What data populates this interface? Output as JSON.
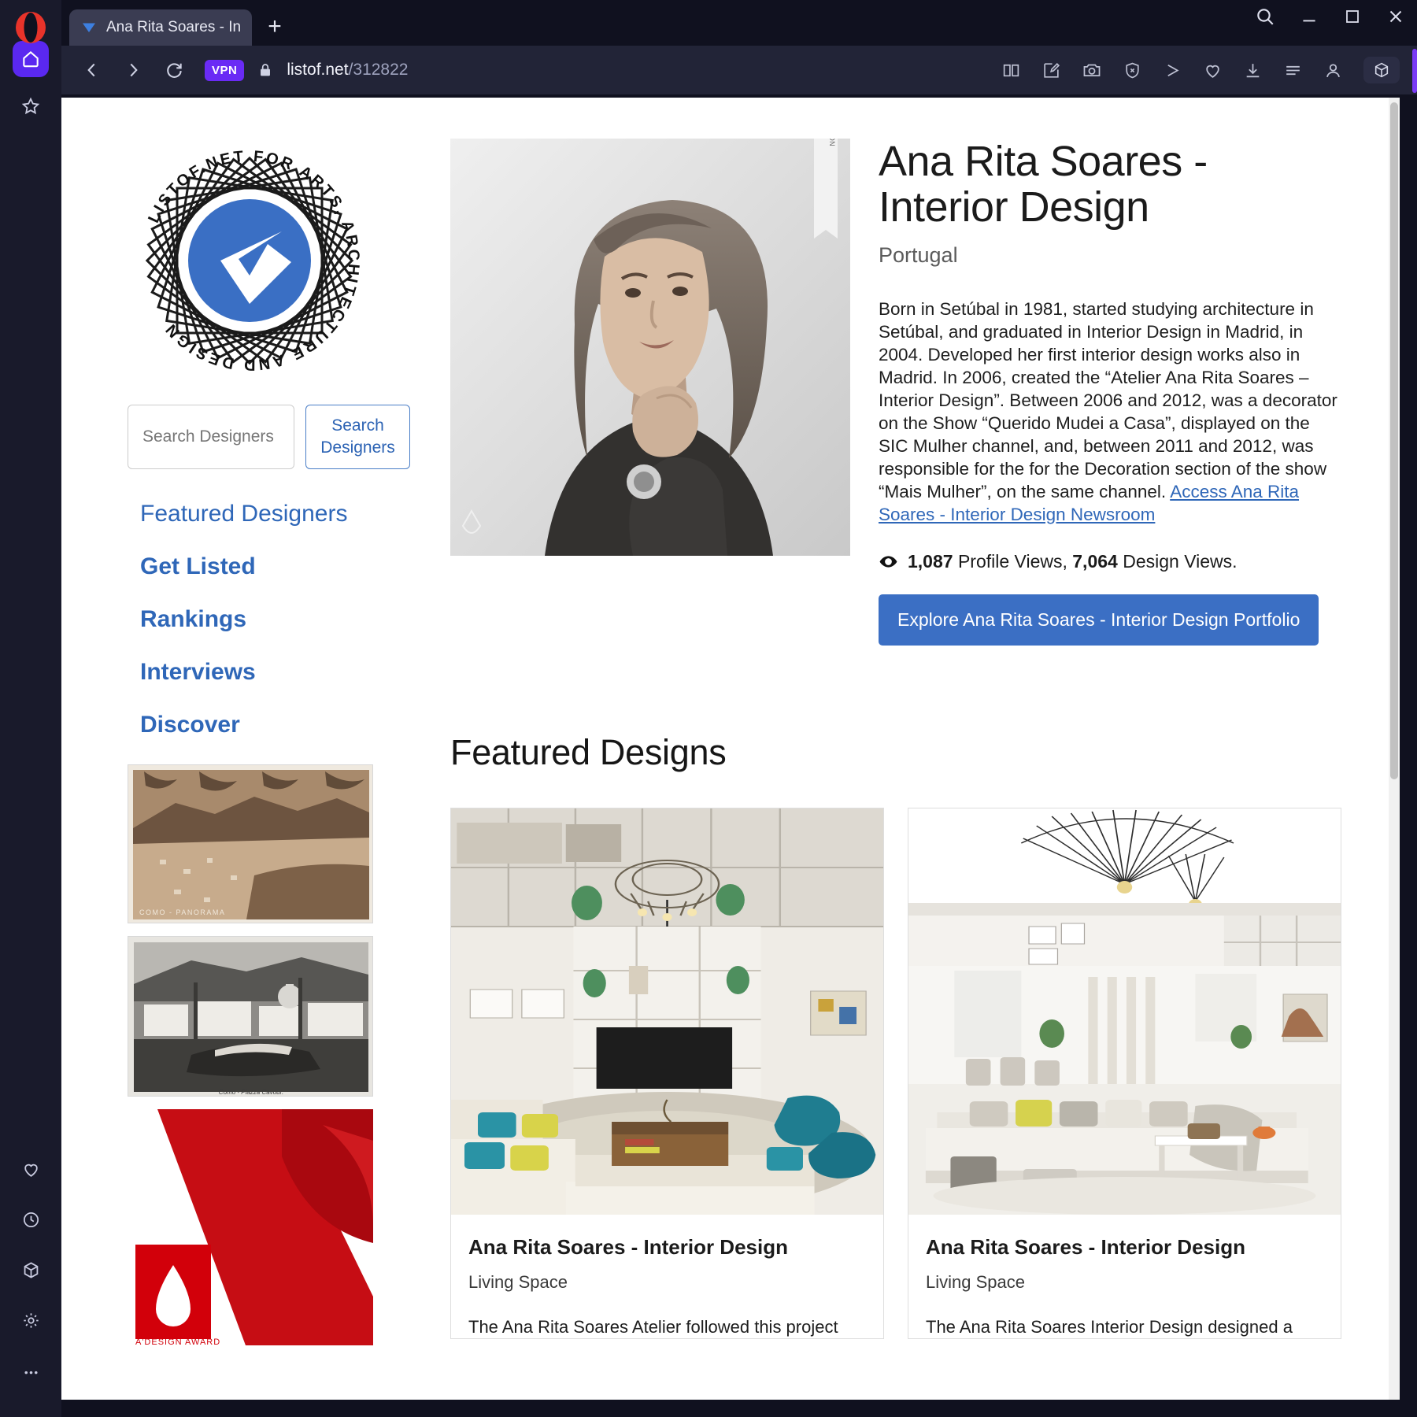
{
  "browser": {
    "tab": {
      "title": "Ana Rita Soares - Interior",
      "favicon": "listof-chevron-icon"
    },
    "new_tab_label": "+",
    "window_controls": {
      "search": "search-icon",
      "minimize": "minimize-icon",
      "maximize": "maximize-icon",
      "close": "close-icon"
    },
    "nav": {
      "back": "back-arrow-icon",
      "forward": "forward-arrow-icon",
      "reload": "reload-icon"
    },
    "vpn_badge": "VPN",
    "lock": "padlock-icon",
    "url_domain": "listof.net",
    "url_path": "/312822",
    "toolbar_icons": [
      "reader-mode-icon",
      "snapshot-edit-icon",
      "camera-icon",
      "shield-blocker-icon",
      "player-icon",
      "heart-icon",
      "downloads-icon",
      "menu-lines-icon",
      "profile-icon",
      "workspace-cube-icon"
    ],
    "rail_icons": [
      "opera-logo-icon",
      "home-icon",
      "star-icon",
      "heart-icon",
      "history-clock-icon",
      "cube-icon",
      "gear-icon",
      "more-dots-icon"
    ],
    "accent_purple": "#6a2bf5",
    "chrome_bg": "#191a2b"
  },
  "sidebar": {
    "logo_text_ring": "LISTOF.NET FOR ARTS, ARCHITECTURE AND DESIGN",
    "search": {
      "placeholder": "Search Designers",
      "value": "",
      "button_label": "Search Designers"
    },
    "nav_items": [
      {
        "label": "Featured Designers",
        "bold": false
      },
      {
        "label": "Get Listed",
        "bold": true
      },
      {
        "label": "Rankings",
        "bold": true
      },
      {
        "label": "Interviews",
        "bold": true
      },
      {
        "label": "Discover",
        "bold": true
      }
    ],
    "thumbnails": [
      {
        "name": "como-panorama-postcard",
        "caption": "COMO - PANORAMA"
      },
      {
        "name": "como-piazza-cavour-postcard",
        "caption": "Como - Piazza Cavour."
      },
      {
        "name": "a-design-award-banner",
        "caption": "A'DESIGN AWARD"
      }
    ],
    "link_color": "#2f67b8"
  },
  "profile": {
    "photo_ribbon": "A'DESIGN AWARD & COMPETITION",
    "name": "Ana Rita Soares - Interior Design",
    "country": "Portugal",
    "bio_before_link": "Born in Setúbal in 1981, started studying architecture in Setúbal, and graduated in Interior Design in Madrid, in 2004. Developed her first interior design works also in Madrid. In 2006, created the “Atelier Ana Rita Soares – Interior Design”. Between 2006 and 2012, was a decorator on the Show “Querido Mudei a Casa”, displayed on the SIC Mulher channel, and, between 2011 and 2012, was responsible for the for the Decoration section of the show “Mais Mulher”, on the same channel. ",
    "bio_link_text": "Access Ana Rita Soares - Interior Design Newsroom",
    "stats": {
      "eye_icon": "eye-icon",
      "profile_views": "1,087",
      "profile_views_label": " Profile Views, ",
      "design_views": "7,064",
      "design_views_label": " Design Views."
    },
    "cta_label": "Explore Ana Rita Soares - Interior Design Portfolio",
    "cta_color": "#3b6fc4"
  },
  "featured": {
    "heading": "Featured Designs",
    "cards": [
      {
        "image_name": "luxury-double-height-living-room",
        "title": "Ana Rita Soares - Interior Design",
        "subtitle": "Living Space",
        "description": "The Ana Rita Soares Atelier followed this project"
      },
      {
        "image_name": "white-open-plan-living-room",
        "title": "Ana Rita Soares - Interior Design",
        "subtitle": "Living Space",
        "description": "The Ana Rita Soares Interior Design designed a"
      }
    ]
  }
}
